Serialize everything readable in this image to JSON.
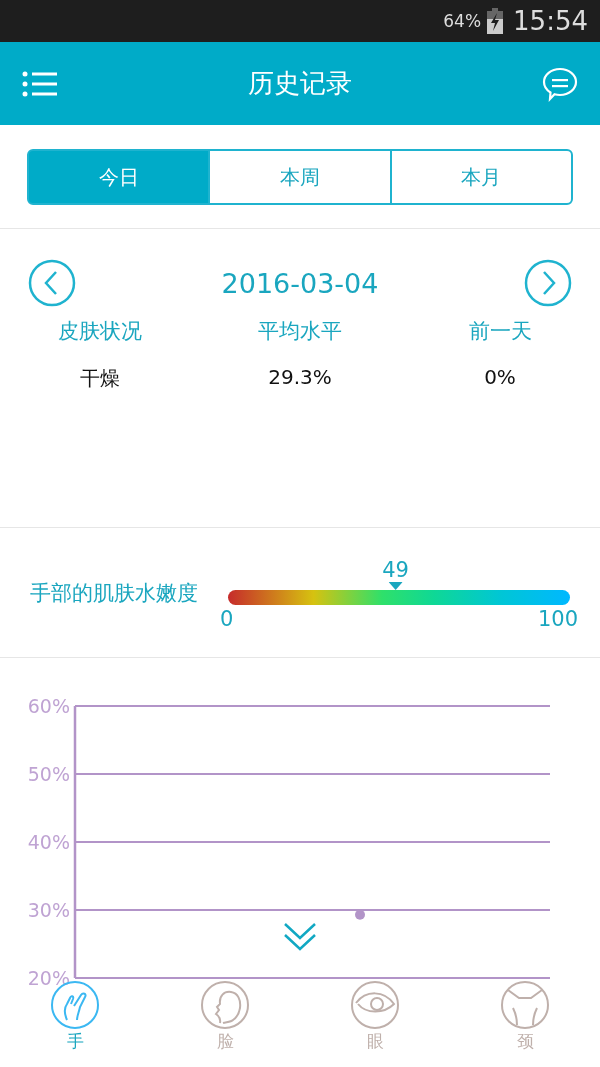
{
  "status_bar": {
    "battery": "64%",
    "time": "15:54"
  },
  "header": {
    "title": "历史记录"
  },
  "tabs": [
    {
      "label": "今日",
      "selected": true
    },
    {
      "label": "本周",
      "selected": false
    },
    {
      "label": "本月",
      "selected": false
    }
  ],
  "date": "2016-03-04",
  "stats": [
    {
      "label": "皮肤状况",
      "value": "干燥"
    },
    {
      "label": "平均水平",
      "value": "29.3%"
    },
    {
      "label": "前一天",
      "value": "0%"
    }
  ],
  "gauge": {
    "label": "手部的肌肤水嫩度",
    "reading": "49",
    "level": 0.49,
    "min": "0",
    "max": "100"
  },
  "chart_data": {
    "type": "scatter",
    "grid": true,
    "categories": [
      null,
      null,
      null,
      null,
      null,
      null
    ],
    "ylim": [
      20,
      60
    ],
    "yticks": [
      {
        "value": 20,
        "label": "20%"
      },
      {
        "value": 30,
        "label": "30%"
      },
      {
        "value": 40,
        "label": "40%"
      },
      {
        "value": 50,
        "label": "50%"
      },
      {
        "value": 60,
        "label": "60%"
      }
    ],
    "series": [
      {
        "color": "#b294c8",
        "values": [
          null,
          null,
          null,
          29.3,
          null,
          null
        ]
      }
    ]
  },
  "nav": [
    {
      "kind": "hand",
      "label": "手",
      "selected": true
    },
    {
      "kind": "face",
      "label": "脸",
      "selected": false
    },
    {
      "kind": "eye",
      "label": "眼",
      "selected": false
    },
    {
      "kind": "neck",
      "label": "颈",
      "selected": false
    }
  ]
}
